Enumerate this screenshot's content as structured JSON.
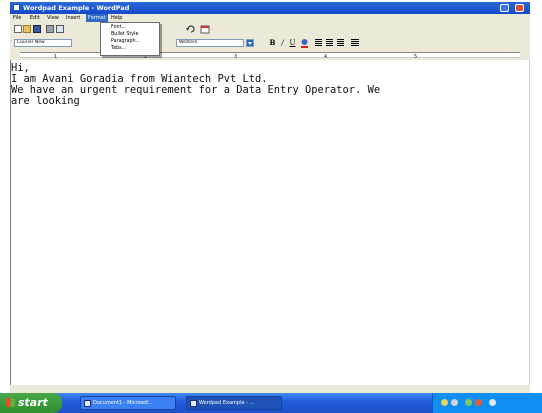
{
  "window": {
    "title": "Wordpad Example - WordPad"
  },
  "menubar": {
    "items": [
      "File",
      "Edit",
      "View",
      "Insert",
      "Format",
      "Help"
    ]
  },
  "format_menu": {
    "items": [
      "Font...",
      "Bullet Style",
      "Paragraph...",
      "Tabs..."
    ]
  },
  "formatting": {
    "font": "Courier New",
    "script": "Western"
  },
  "ruler": {
    "numbers": [
      "1",
      "2",
      "3",
      "4",
      "5"
    ]
  },
  "document": {
    "lines": [
      "Hi,",
      "I am Avani Goradia from Wiantech Pvt Ltd.",
      "We have an urgent requirement for a Data Entry Operator. We",
      "are looking"
    ]
  },
  "taskbar": {
    "start_label": "start",
    "tasks": [
      "Document1 - Microsof...",
      "Wordpad Example - ..."
    ]
  },
  "icons": {
    "app": "wordpad-icon",
    "new": "new-document-icon",
    "open": "open-folder-icon",
    "save": "save-disk-icon",
    "print": "printer-icon",
    "preview": "print-preview-icon",
    "undo": "undo-icon",
    "datetime": "date-time-icon",
    "bold": "bold-icon",
    "italic": "italic-icon",
    "underline": "underline-icon",
    "color": "font-color-icon",
    "align_left": "align-left-icon",
    "align_center": "align-center-icon",
    "align_right": "align-right-icon",
    "bullets": "bullets-icon",
    "start": "windows-flag-icon"
  },
  "colors": {
    "titlebar": "#1449c9",
    "menu_face": "#ece9d8",
    "menu_highlight": "#316ac5",
    "taskbar": "#245edb",
    "start_green": "#2f8f2f",
    "tray": "#0f8ff2"
  }
}
